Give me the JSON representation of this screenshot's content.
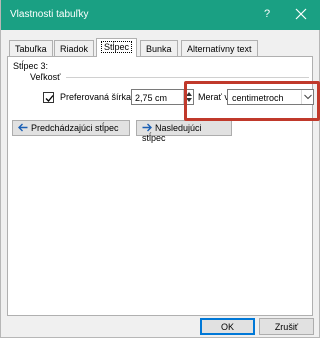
{
  "window": {
    "title": "Vlastnosti tabuľky",
    "help": "?"
  },
  "tabs": [
    {
      "label": "Tabuľka",
      "active": false
    },
    {
      "label": "Riadok",
      "active": false
    },
    {
      "label": "Stĺpec",
      "active": true
    },
    {
      "label": "Bunka",
      "active": false
    },
    {
      "label": "Alternatívny text",
      "active": false
    }
  ],
  "column_tab": {
    "section_label": "Stĺpec 3:",
    "size_group": "Veľkosť",
    "preferred_width": {
      "label": "Preferovaná šírka:",
      "checked": true,
      "value": "2,75 cm"
    },
    "measure_in": {
      "label": "Merať v:",
      "value": "centimetroch"
    },
    "prev_button": "Predchádzajúci stĺpec",
    "next_button": "Nasledujúci stĺpec"
  },
  "footer": {
    "ok": "OK",
    "cancel": "Zrušiť"
  },
  "colors": {
    "titlebar": "#1aa083",
    "highlight": "#c0392b",
    "arrow": "#1a5fb4"
  }
}
